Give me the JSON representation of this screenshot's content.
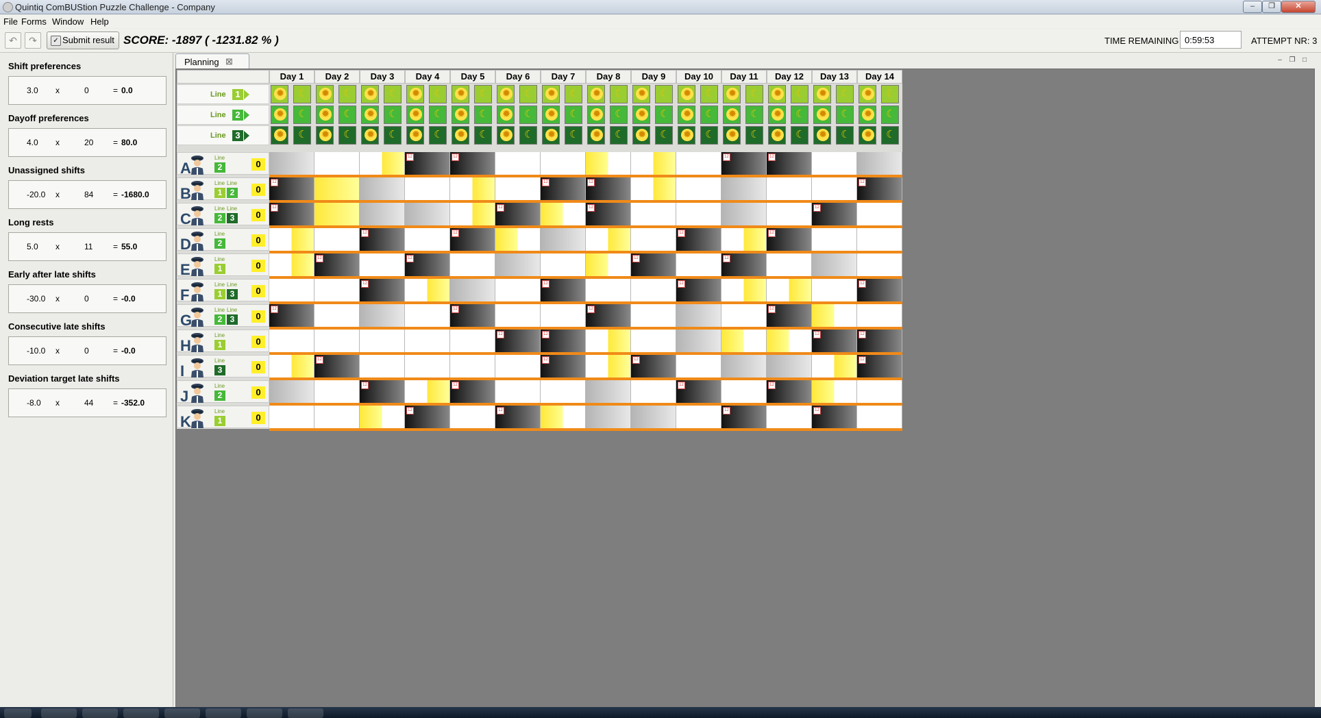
{
  "window": {
    "title": "Quintiq ComBUStion Puzzle Challenge - Company"
  },
  "menu": [
    "File",
    "Forms",
    "Window",
    "Help"
  ],
  "toolbar": {
    "submit_label": "Submit result",
    "score_text": "SCORE: -1897  ( -1231.82 % )",
    "time_label": "TIME REMAINING",
    "time_value": "0:59:53",
    "attempt_text": "ATTEMPT NR: 3"
  },
  "criteria": [
    {
      "name": "Shift preferences",
      "weight": "3.0",
      "count": "0",
      "result": "0.0"
    },
    {
      "name": "Dayoff preferences",
      "weight": "4.0",
      "count": "20",
      "result": "80.0"
    },
    {
      "name": "Unassigned shifts",
      "weight": "-20.0",
      "count": "84",
      "result": "-1680.0"
    },
    {
      "name": "Long rests",
      "weight": "5.0",
      "count": "11",
      "result": "55.0"
    },
    {
      "name": "Early after late shifts",
      "weight": "-30.0",
      "count": "0",
      "result": "-0.0"
    },
    {
      "name": "Consecutive late shifts",
      "weight": "-10.0",
      "count": "0",
      "result": "-0.0"
    },
    {
      "name": "Deviation target late shifts",
      "weight": "-8.0",
      "count": "44",
      "result": "-352.0"
    }
  ],
  "planning_tab": {
    "label": "Planning",
    "close_glyph": "⊠"
  },
  "days": [
    "Day 1",
    "Day 2",
    "Day 3",
    "Day 4",
    "Day 5",
    "Day 6",
    "Day 7",
    "Day 8",
    "Day 9",
    "Day 10",
    "Day 11",
    "Day 12",
    "Day 13",
    "Day 14"
  ],
  "lines": [
    {
      "label": "Line",
      "number": "1",
      "color": "#9acd32"
    },
    {
      "label": "Line",
      "number": "2",
      "color": "#46b83a"
    },
    {
      "label": "Line",
      "number": "3",
      "color": "#1f6b2a"
    }
  ],
  "shift_glyphs": {
    "early": "✹",
    "late": "☾"
  },
  "drivers": [
    {
      "letter": "A",
      "lines": [
        "2"
      ],
      "count": "0",
      "cells": [
        "G",
        "W",
        "WY",
        "D",
        "D",
        "W",
        "W",
        "YW",
        "WY",
        "W",
        "D",
        "D",
        "W",
        "G"
      ]
    },
    {
      "letter": "B",
      "lines": [
        "1",
        "2"
      ],
      "count": "0",
      "cells": [
        "D",
        "Y",
        "G",
        "W",
        "WY",
        "W",
        "D",
        "D",
        "WY",
        "W",
        "G",
        "W",
        "W",
        "D"
      ]
    },
    {
      "letter": "C",
      "lines": [
        "2",
        "3"
      ],
      "count": "0",
      "cells": [
        "D",
        "Y",
        "G",
        "G",
        "WY",
        "D",
        "YW",
        "D",
        "W",
        "W",
        "G",
        "W",
        "D",
        "W"
      ]
    },
    {
      "letter": "D",
      "lines": [
        "2"
      ],
      "count": "0",
      "cells": [
        "WY",
        "W",
        "D",
        "W",
        "D",
        "YW",
        "G",
        "WY",
        "W",
        "D",
        "WY",
        "D",
        "W",
        "W"
      ]
    },
    {
      "letter": "E",
      "lines": [
        "1"
      ],
      "count": "0",
      "cells": [
        "WY",
        "D",
        "W",
        "D",
        "W",
        "G",
        "W",
        "YW",
        "D",
        "W",
        "D",
        "W",
        "G",
        "W"
      ]
    },
    {
      "letter": "F",
      "lines": [
        "1",
        "3"
      ],
      "count": "0",
      "cells": [
        "W",
        "W",
        "D",
        "WY",
        "G",
        "W",
        "D",
        "W",
        "W",
        "D",
        "WY",
        "WY",
        "W",
        "D"
      ]
    },
    {
      "letter": "G",
      "lines": [
        "2",
        "3"
      ],
      "count": "0",
      "cells": [
        "D",
        "W",
        "G",
        "W",
        "D",
        "W",
        "W",
        "D",
        "W",
        "G",
        "W",
        "D",
        "YW",
        "W"
      ]
    },
    {
      "letter": "H",
      "lines": [
        "1"
      ],
      "count": "0",
      "cells": [
        "W",
        "W",
        "W",
        "W",
        "W",
        "D",
        "D",
        "WY",
        "W",
        "G",
        "YW",
        "YW",
        "D",
        "D"
      ]
    },
    {
      "letter": "I",
      "lines": [
        "3"
      ],
      "count": "0",
      "cells": [
        "WY",
        "D",
        "W",
        "W",
        "W",
        "W",
        "D",
        "WY",
        "D",
        "W",
        "G",
        "G",
        "WY",
        "D"
      ]
    },
    {
      "letter": "J",
      "lines": [
        "2"
      ],
      "count": "0",
      "cells": [
        "G",
        "W",
        "D",
        "WY",
        "D",
        "W",
        "W",
        "G",
        "W",
        "D",
        "W",
        "D",
        "YW",
        "W"
      ]
    },
    {
      "letter": "K",
      "lines": [
        "1"
      ],
      "count": "0",
      "cells": [
        "W",
        "W",
        "YW",
        "D",
        "W",
        "D",
        "YW",
        "G",
        "G",
        "W",
        "D",
        "W",
        "D",
        "W"
      ]
    }
  ]
}
